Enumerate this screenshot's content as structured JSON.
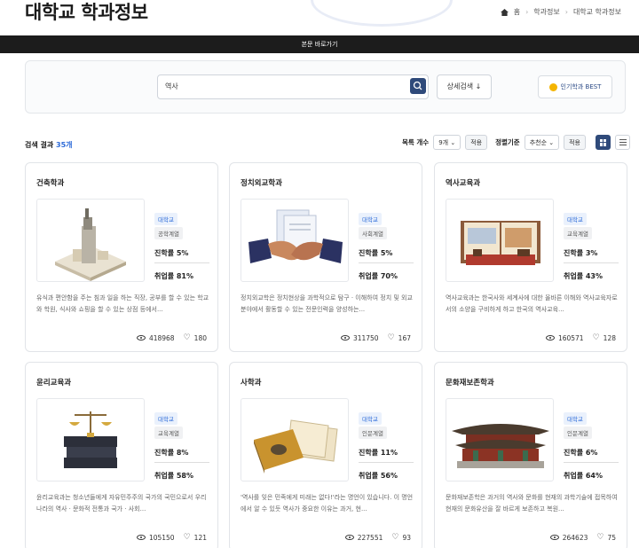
{
  "header": {
    "title": "대학교 학과정보"
  },
  "breadcrumb": {
    "home": "홈",
    "level1": "학과정보",
    "level2": "대학교 학과정보"
  },
  "skip_bar": {
    "label": "본문 바로가기"
  },
  "search": {
    "value": "역사",
    "detail_label": "상세검색 ↓",
    "best_label": "인기학과 BEST"
  },
  "results": {
    "label": "검색 결과",
    "count": "35개"
  },
  "controls": {
    "rows_label": "목록 개수",
    "rows_value": "9개 ⌄",
    "rows_apply": "적용",
    "sort_label": "정렬기준",
    "sort_value": "추천순 ⌄",
    "sort_apply": "적용"
  },
  "cards": [
    {
      "title": "건축학과",
      "tag1": "대학교",
      "tag2": "공학계열",
      "enroll": "진학률 5%",
      "employ": "취업률 81%",
      "desc": "유식과 편안함을 주는 침과 일을 하는 직장, 공부를 할 수 있는 학교와 학원, 식사와 쇼핑을 할 수 있는 상점 등에서...",
      "views": "418968",
      "likes": "180"
    },
    {
      "title": "정치외교학과",
      "tag1": "대학교",
      "tag2": "사회계열",
      "enroll": "진학률 5%",
      "employ": "취업률 70%",
      "desc": "정치외교학은 정치현상을 과학적으로 탐구 · 이해하여 정치 및 외교분야에서 활동할 수 있는 전문인력을 양성하는...",
      "views": "311750",
      "likes": "167"
    },
    {
      "title": "역사교육과",
      "tag1": "대학교",
      "tag2": "교육계열",
      "enroll": "진학률 3%",
      "employ": "취업률 43%",
      "desc": "역사교육과는 한국사와 세계사에 대한 올바른 이해와 역사교육자로서의 소양을 구비하게 하고 한국의 역사교육...",
      "views": "160571",
      "likes": "128"
    },
    {
      "title": "윤리교육과",
      "tag1": "대학교",
      "tag2": "교육계열",
      "enroll": "진학률 8%",
      "employ": "취업률 58%",
      "desc": "윤리교육과는 청소년들에게 자유민주주의 국가의 국민으로서 우리나라의 역사 · 문화적 전통과 국가 · 사회...",
      "views": "105150",
      "likes": "121"
    },
    {
      "title": "사학과",
      "tag1": "대학교",
      "tag2": "인문계열",
      "enroll": "진학률 11%",
      "employ": "취업률 56%",
      "desc": "'역사를 잊은 민족에게 미래는 없다!'라는 명언이 있습니다. 이 명언에서 알 수 있듯 역사가 중요한 이유는 과거, 현...",
      "views": "227551",
      "likes": "93"
    },
    {
      "title": "문화재보존학과",
      "tag1": "대학교",
      "tag2": "인문계열",
      "enroll": "진학률 6%",
      "employ": "취업률 64%",
      "desc": "문화재보존학은 과거의 역사와 문화를 현재의 과학기술에 접목하여 현재의 문화유산을 잘 바르게 보존하고 복원...",
      "views": "264623",
      "likes": "75"
    }
  ]
}
